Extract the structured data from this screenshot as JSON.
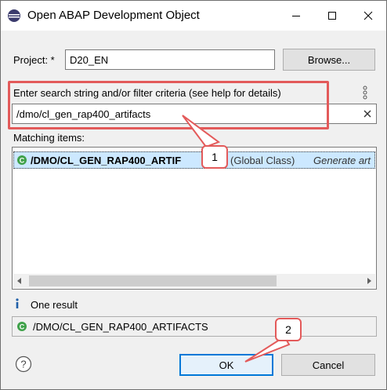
{
  "window": {
    "title": "Open ABAP Development Object",
    "minimize_icon": "minimize-icon",
    "maximize_icon": "maximize-icon",
    "close_icon": "close-icon"
  },
  "project": {
    "label": "Project: *",
    "value": "D20_EN",
    "browse_label": "Browse..."
  },
  "search": {
    "label": "Enter search string and/or filter criteria (see help for details)",
    "value": "/dmo/cl_gen_rap400_artifacts",
    "help_icon": "help-dots-icon",
    "clear_icon": "clear-icon"
  },
  "matching": {
    "label": "Matching items:",
    "items": [
      {
        "name": "/DMO/CL_GEN_RAP400_ARTIF",
        "type": "(Global Class)",
        "description": "Generate art",
        "icon": "class-icon"
      }
    ]
  },
  "result": {
    "info_icon": "info-icon",
    "count_text": "One result",
    "selected": "/DMO/CL_GEN_RAP400_ARTIFACTS"
  },
  "footer": {
    "help_icon": "question-icon",
    "ok_label": "OK",
    "cancel_label": "Cancel"
  },
  "annotations": {
    "badge1": "1",
    "badge2": "2",
    "color": "#e35a5a"
  }
}
